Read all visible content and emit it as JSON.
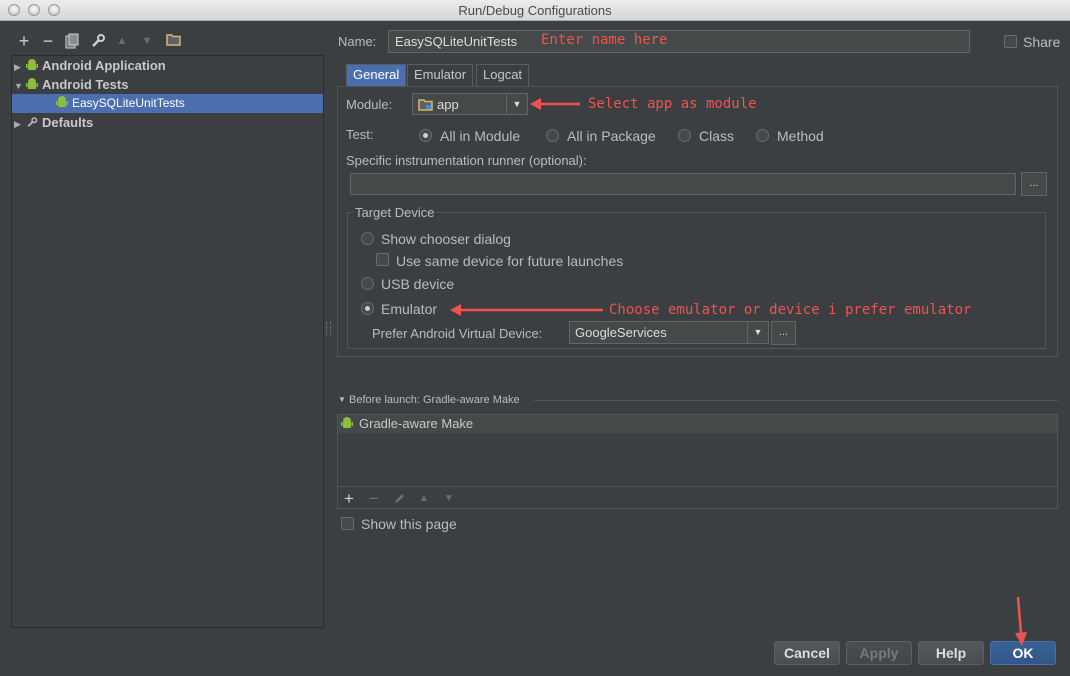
{
  "window": {
    "title": "Run/Debug Configurations"
  },
  "toolbar": {
    "icons": [
      "add-icon",
      "remove-icon",
      "copy-icon",
      "wrench-icon",
      "arrow-up-icon",
      "arrow-down-icon",
      "folder-icon"
    ]
  },
  "tree": {
    "items": [
      {
        "label": "Android Application",
        "expanded": false
      },
      {
        "label": "Android Tests",
        "expanded": true
      },
      {
        "label": "EasySQLiteUnitTests",
        "selected": true
      },
      {
        "label": "Defaults",
        "expanded": false
      }
    ]
  },
  "name": {
    "label": "Name:",
    "value": "EasySQLiteUnitTests",
    "hint": "Enter name here"
  },
  "share": {
    "label": "Share"
  },
  "tabs": [
    "General",
    "Emulator",
    "Logcat"
  ],
  "module": {
    "label": "Module:",
    "value": "app",
    "hint": "Select app as module"
  },
  "test": {
    "label": "Test:",
    "options": [
      "All in Module",
      "All in Package",
      "Class",
      "Method"
    ],
    "selected": "All in Module"
  },
  "runner": {
    "label": "Specific instrumentation runner (optional):",
    "value": "",
    "browse": "..."
  },
  "target": {
    "title": "Target Device",
    "show_chooser": "Show chooser dialog",
    "same_device": "Use same device for future launches",
    "usb": "USB device",
    "emulator": "Emulator",
    "emulator_hint": "Choose emulator or device i prefer emulator",
    "avd_label": "Prefer Android Virtual Device:",
    "avd_value": "GoogleServices",
    "browse": "..."
  },
  "before_launch": {
    "title": "Before launch: Gradle-aware Make",
    "item": "Gradle-aware Make"
  },
  "show_page": {
    "label": "Show this page"
  },
  "buttons": {
    "cancel": "Cancel",
    "apply": "Apply",
    "help": "Help",
    "ok": "OK"
  },
  "colors": {
    "background": "#3c3f41",
    "selection": "#4b6eaf",
    "annotation": "#ef5350",
    "android_green": "#8bbf3c"
  }
}
